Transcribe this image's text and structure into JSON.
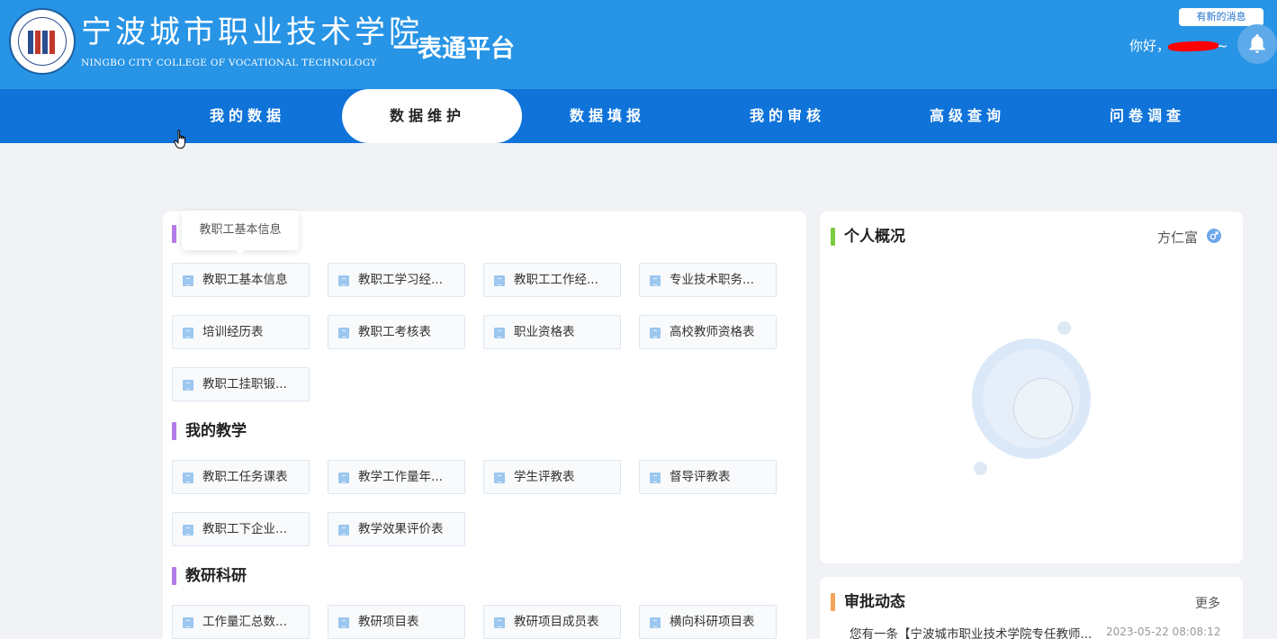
{
  "header": {
    "school_name_cn": "宁波城市职业技术学院",
    "school_name_en": "NINGBO CITY COLLEGE OF VOCATIONAL TECHNOLOGY",
    "platform_title": "一表通平台",
    "new_message": "有新的消息",
    "greeting_prefix": "你好，",
    "greeting_suffix": "~",
    "icon": "bell-icon"
  },
  "nav": {
    "items": [
      "我的数据",
      "数据维护",
      "数据填报",
      "我的审核",
      "高级查询",
      "问卷调查"
    ],
    "active": "数据维护"
  },
  "tooltip": "教职工基本信息",
  "sections": [
    {
      "title": "",
      "tiles": [
        "教职工基本信息",
        "教职工学习经...",
        "教职工工作经...",
        "专业技术职务...",
        "培训经历表",
        "教职工考核表",
        "职业资格表",
        "高校教师资格表",
        "教职工挂职锻..."
      ]
    },
    {
      "title": "我的教学",
      "tiles": [
        "教职工任务课表",
        "教学工作量年...",
        "学生评教表",
        "督导评教表",
        "教职工下企业...",
        "教学效果评价表"
      ]
    },
    {
      "title": "教研科研",
      "tiles": [
        "工作量汇总数...",
        "教研项目表",
        "教研项目成员表",
        "横向科研项目表"
      ]
    }
  ],
  "profile": {
    "title": "个人概况",
    "name": "方仁富",
    "gender_icon": "male-icon"
  },
  "approval": {
    "title": "审批动态",
    "more": "更多",
    "message": "您有一条【宁波城市职业技术学院专任教师...",
    "time": "2023-05-22 08:08:12"
  },
  "colors": {
    "header_bg": "#2794e6",
    "nav_bg": "#0f73d9",
    "section_bar": "#b57be8",
    "profile_bar": "#7ccc3f",
    "approval_bar": "#f5a35b"
  }
}
